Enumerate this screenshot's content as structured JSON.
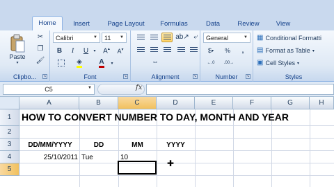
{
  "ribbon": {
    "tabs": [
      {
        "label": "Home",
        "active": true
      },
      {
        "label": "Insert"
      },
      {
        "label": "Page Layout"
      },
      {
        "label": "Formulas"
      },
      {
        "label": "Data"
      },
      {
        "label": "Review"
      },
      {
        "label": "View"
      }
    ],
    "clipboard": {
      "paste_label": "Paste",
      "group_label": "Clipbo..."
    },
    "font": {
      "font_name": "Calibri",
      "font_size": "11",
      "group_label": "Font"
    },
    "alignment": {
      "group_label": "Alignment"
    },
    "number": {
      "format": "General",
      "currency_symbol": "$",
      "percent_symbol": "%",
      "comma_symbol": ",",
      "group_label": "Number"
    },
    "styles": {
      "conditional_formatting": "Conditional Formatti",
      "format_as_table": "Format as Table",
      "cell_styles": "Cell Styles",
      "group_label": "Styles"
    }
  },
  "formula_bar": {
    "name_box": "C5",
    "fx_label": "fx",
    "formula": ""
  },
  "sheet": {
    "columns": [
      "A",
      "B",
      "C",
      "D",
      "E",
      "F",
      "G",
      "H"
    ],
    "rows": [
      "1",
      "2",
      "3",
      "4",
      "5"
    ],
    "selected_column": "C",
    "selected_row": "5",
    "cells": {
      "A1": "HOW TO CONVERT NUMBER TO DAY, MONTH AND YEAR",
      "A3": "DD/MM/YYYY",
      "B3": "DD",
      "C3": "MM",
      "D3": "YYYY",
      "A4": "25/10/2011",
      "B4": "Tue",
      "C4": "10"
    }
  },
  "accent_colors": {
    "ribbon": "#c9d9ee",
    "selection_header": "#f1c15f",
    "font_color_bar": "#c00000"
  }
}
